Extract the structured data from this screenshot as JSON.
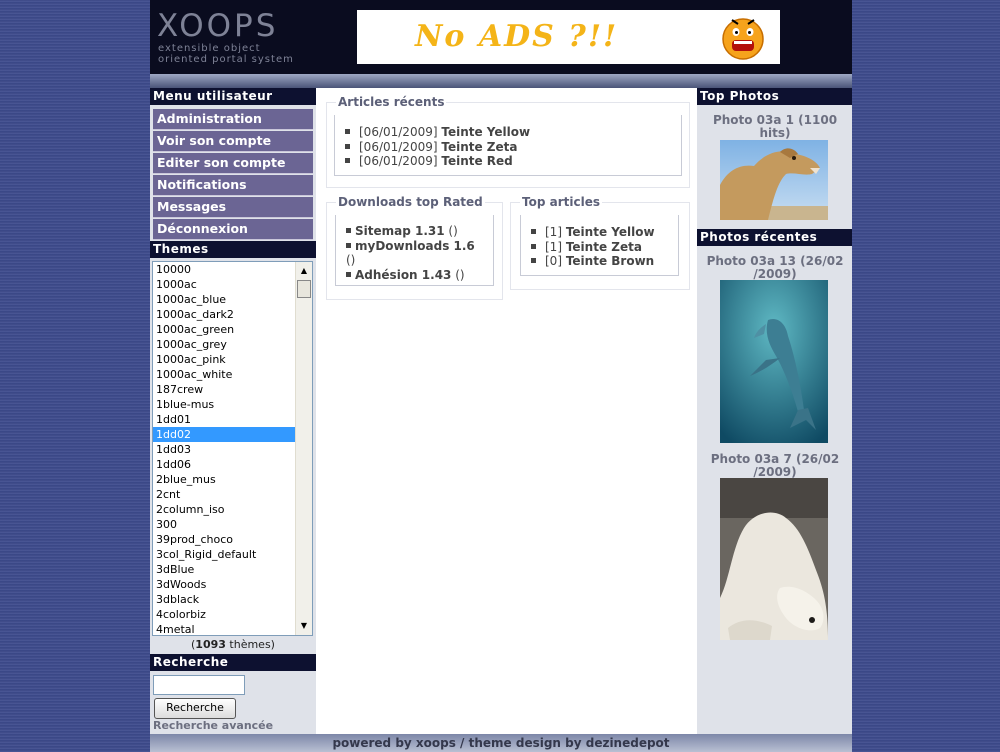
{
  "header": {
    "logo_main": "XOOPS",
    "logo_line1": "extensible object",
    "logo_line2": "oriented portal system",
    "banner_text": "No ADS ?!!"
  },
  "user_menu": {
    "title": "Menu utilisateur",
    "items": [
      "Administration",
      "Voir son compte",
      "Editer son compte",
      "Notifications",
      "Messages",
      "Déconnexion"
    ]
  },
  "themes": {
    "title": "Themes",
    "selected": "1dd02",
    "items": [
      "10000",
      "1000ac",
      "1000ac_blue",
      "1000ac_dark2",
      "1000ac_green",
      "1000ac_grey",
      "1000ac_pink",
      "1000ac_white",
      "187crew",
      "1blue-mus",
      "1dd01",
      "1dd02",
      "1dd03",
      "1dd06",
      "2blue_mus",
      "2cnt",
      "2column_iso",
      "300",
      "39prod_choco",
      "3col_Rigid_default",
      "3dBlue",
      "3dWoods",
      "3dblack",
      "4colorbiz",
      "4metal"
    ],
    "count_open": "(",
    "count": "1093",
    "count_suffix": " thèmes)"
  },
  "search": {
    "title": "Recherche",
    "value": "",
    "button": "Recherche",
    "advanced": "Recherche avancée"
  },
  "recent_articles": {
    "title": "Articles récents",
    "items": [
      {
        "date": "[06/01/2009]",
        "name": "Teinte Yellow"
      },
      {
        "date": "[06/01/2009]",
        "name": "Teinte Zeta"
      },
      {
        "date": "[06/01/2009]",
        "name": "Teinte Red"
      }
    ]
  },
  "downloads": {
    "title": "Downloads top Rated",
    "items": [
      {
        "name": "Sitemap 1.31",
        "extra": " ()"
      },
      {
        "name": "myDownloads 1.6",
        "extra": " ()"
      },
      {
        "name": "Adhésion 1.43",
        "extra": " ()"
      }
    ]
  },
  "top_articles": {
    "title": "Top articles",
    "items": [
      {
        "rank": "[1]",
        "name": "Teinte Yellow"
      },
      {
        "rank": "[1]",
        "name": "Teinte Zeta"
      },
      {
        "rank": "[0]",
        "name": "Teinte Brown"
      }
    ]
  },
  "top_photos": {
    "title": "Top Photos",
    "caption": "Photo 03a 1 (1100 hits)"
  },
  "recent_photos": {
    "title": "Photos récentes",
    "captions": [
      "Photo 03a 13 (26/02 /2009)",
      "Photo 03a 7 (26/02 /2009)"
    ]
  },
  "footer": {
    "text": "powered by xoops / theme design by dezinedepot"
  },
  "colors": {
    "body_bg": "#3d4a8c",
    "header_bg": "#0a0c1f",
    "block_title_bg": "#0d1130",
    "menu_item_bg": "#6b6594",
    "selected_item_bg": "#3399ff",
    "banner_text": "#f4b418"
  }
}
